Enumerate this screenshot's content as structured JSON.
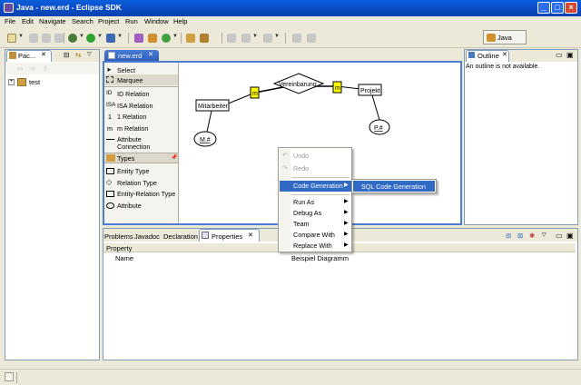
{
  "window": {
    "title": "Java - new.erd - Eclipse SDK",
    "min": "_",
    "max": "□",
    "close": "×"
  },
  "menu": [
    "File",
    "Edit",
    "Navigate",
    "Search",
    "Project",
    "Run",
    "Window",
    "Help"
  ],
  "perspective": {
    "label": "Java"
  },
  "package_explorer": {
    "tab": "Pac...",
    "tree_root": "test"
  },
  "editor": {
    "tab": "new.erd"
  },
  "palette": {
    "tools": [
      "Select",
      "Marquee"
    ],
    "relations": [
      "ID Relation",
      "ISA Relation",
      "1 Relation",
      "m Relation",
      "Attribute",
      "Connection"
    ],
    "relation_icons": [
      "ID",
      "ISA",
      "1",
      "m"
    ],
    "types_header": "Types",
    "types": [
      "Entity Type",
      "Relation Type",
      "Entity-Relation Type",
      "Attribute"
    ]
  },
  "diagram": {
    "entities": [
      "Mitarbeiter",
      "Projekt"
    ],
    "relation": "Vereinbarung",
    "cardinalities": [
      "m",
      "m"
    ],
    "attributes": [
      "M.#",
      "P.#"
    ]
  },
  "outline": {
    "tab": "Outline",
    "message": "An outline is not available."
  },
  "bottom_tabs": [
    "Problems",
    "Javadoc",
    "Declaration",
    "Properties"
  ],
  "properties": {
    "header": "Property",
    "rows": [
      {
        "name": "Name",
        "value": "Beispiel Diagramm"
      }
    ]
  },
  "context_menu": {
    "undo": "Undo",
    "redo": "Redo",
    "code_generation": "Code Generation",
    "items": [
      "Run As",
      "Debug As",
      "Team",
      "Compare With",
      "Replace With"
    ]
  },
  "submenu": {
    "item": "SQL Code Generation"
  },
  "colors": {
    "accent": "#316ac5",
    "title_bar": "#0a5fe0",
    "cardinality_box": "#ffff00"
  }
}
